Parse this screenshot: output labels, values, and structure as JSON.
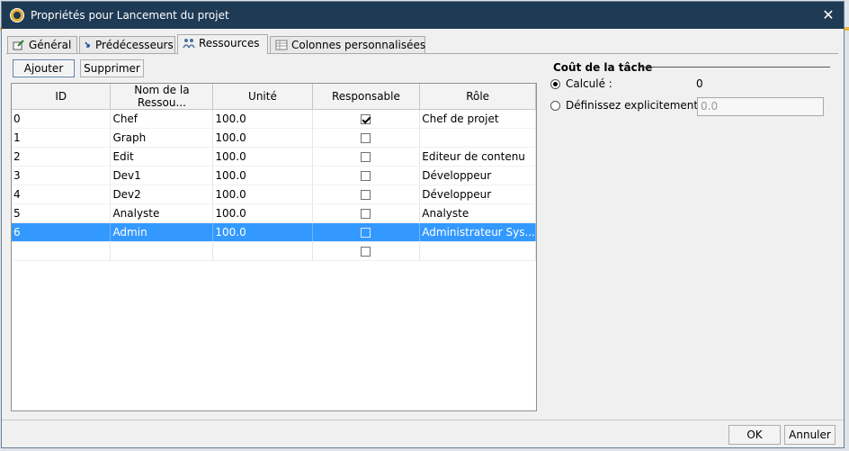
{
  "window": {
    "title": "Propriétés pour Lancement du projet"
  },
  "tabs": [
    {
      "label": "Général",
      "icon": "pencil-doc-icon"
    },
    {
      "label": "Prédécesseurs",
      "icon": "link-arrow-icon"
    },
    {
      "label": "Ressources",
      "icon": "people-icon",
      "active": true
    },
    {
      "label": "Colonnes personnalisées",
      "icon": "table-icon"
    }
  ],
  "toolbar": {
    "add_label": "Ajouter",
    "remove_label": "Supprimer"
  },
  "table": {
    "columns": [
      "ID",
      "Nom de la Ressou...",
      "Unité",
      "Responsable",
      "Rôle"
    ],
    "rows": [
      {
        "id": "0",
        "name": "Chef",
        "unit": "100.0",
        "responsible": true,
        "role": "Chef de projet"
      },
      {
        "id": "1",
        "name": "Graph",
        "unit": "100.0",
        "responsible": false,
        "role": ""
      },
      {
        "id": "2",
        "name": "Edit",
        "unit": "100.0",
        "responsible": false,
        "role": "Editeur de contenu"
      },
      {
        "id": "3",
        "name": "Dev1",
        "unit": "100.0",
        "responsible": false,
        "role": "Développeur"
      },
      {
        "id": "4",
        "name": "Dev2",
        "unit": "100.0",
        "responsible": false,
        "role": "Développeur"
      },
      {
        "id": "5",
        "name": "Analyste",
        "unit": "100.0",
        "responsible": false,
        "role": "Analyste"
      },
      {
        "id": "6",
        "name": "Admin",
        "unit": "100.0",
        "responsible": false,
        "role": "Administrateur Sys...",
        "selected": true
      },
      {
        "id": "",
        "name": "",
        "unit": "",
        "responsible": false,
        "role": ""
      }
    ]
  },
  "cost": {
    "title": "Coût de la tâche",
    "calculated_label": "Calculé :",
    "calculated_value": "0",
    "explicit_label": "Définissez explicitement :",
    "explicit_value": "0.0"
  },
  "footer": {
    "ok_label": "OK",
    "cancel_label": "Annuler"
  },
  "colors": {
    "titlebar": "#1f3a54",
    "selection": "#3399ff",
    "dialog_bg": "#f0f0f0"
  }
}
